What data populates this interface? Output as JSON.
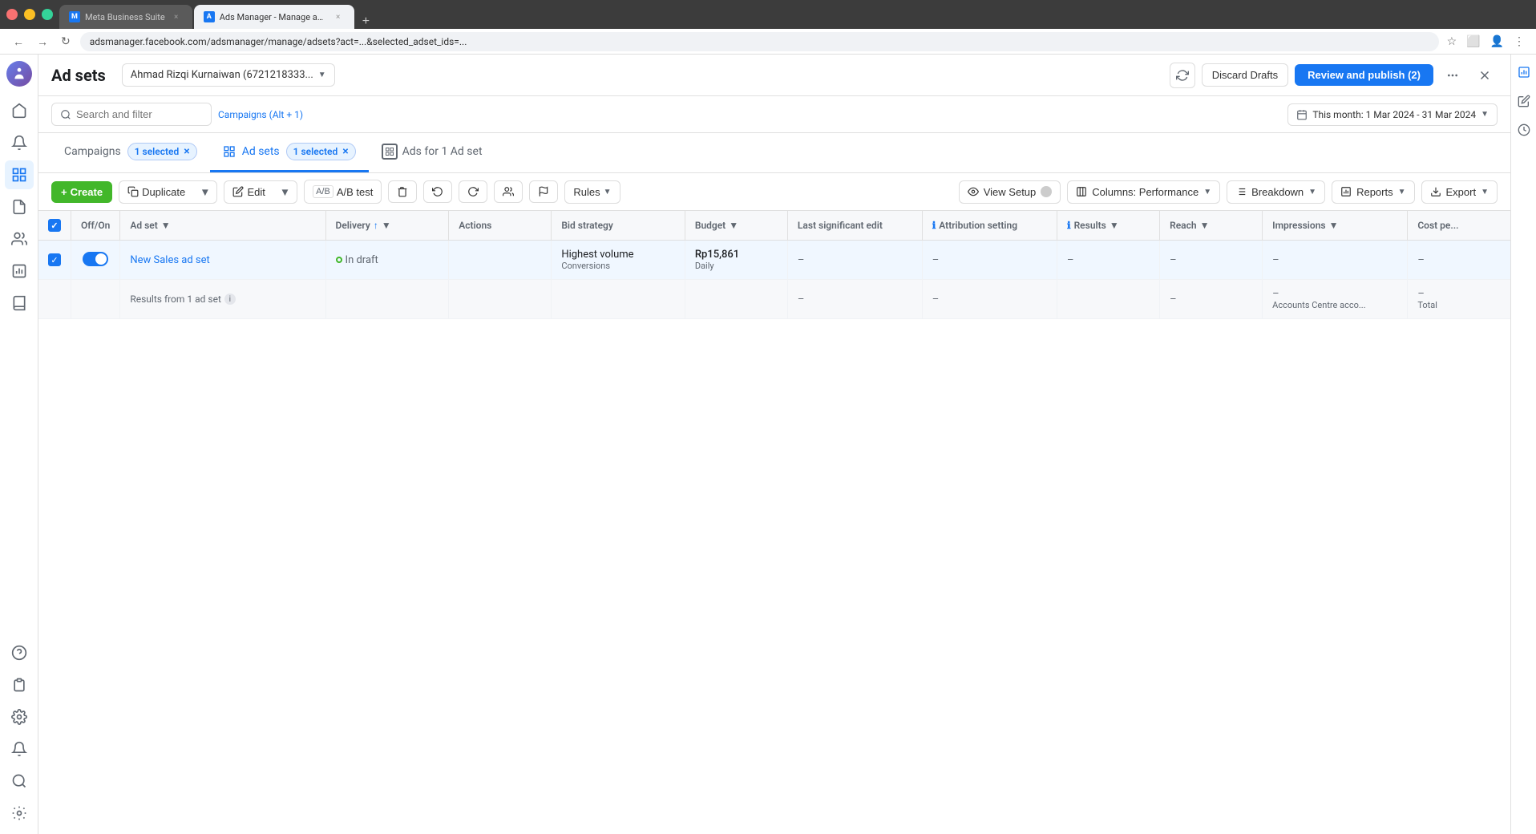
{
  "browser": {
    "tabs": [
      {
        "id": "meta",
        "title": "Meta Business Suite",
        "favicon": "M",
        "active": false
      },
      {
        "id": "ads",
        "title": "Ads Manager - Manage ads -",
        "favicon": "A",
        "active": true
      }
    ],
    "url": "adsmanager.facebook.com/adsmanager/manage/adsets?act=...&selected_adset_ids=..."
  },
  "topbar": {
    "page_title": "Ad sets",
    "account_name": "Ahmad Rizqi Kurnaiwan (6721218333...",
    "refresh_label": "↺",
    "discard_label": "Discard Drafts",
    "review_label": "Review and publish (2)",
    "more_label": "···",
    "close_label": "×"
  },
  "filter_bar": {
    "search_placeholder": "Search and filter",
    "campaigns_label": "Campaigns (Alt + 1)",
    "date_range": "This month: 1 Mar 2024 - 31 Mar 2024"
  },
  "nav_tabs": {
    "campaigns_label": "Campaigns",
    "campaigns_selected": "1 selected",
    "adsets_label": "Ad sets",
    "adsets_selected": "1 selected",
    "ads_for_label": "Ads for 1 Ad set",
    "ads_icon": "⊞"
  },
  "toolbar": {
    "create_label": "Create",
    "duplicate_label": "Duplicate",
    "edit_label": "Edit",
    "ab_test_label": "A/B test",
    "delete_label": "🗑",
    "undo_label": "↺",
    "redo_label": "↻",
    "people_label": "👥",
    "flag_label": "⚑",
    "rules_label": "Rules",
    "view_setup_label": "View Setup",
    "columns_label": "Columns: Performance",
    "breakdown_label": "Breakdown",
    "reports_label": "Reports",
    "export_label": "Export"
  },
  "table": {
    "columns": [
      {
        "id": "checkbox",
        "label": ""
      },
      {
        "id": "toggle",
        "label": "Off/On"
      },
      {
        "id": "adset",
        "label": "Ad set"
      },
      {
        "id": "delivery",
        "label": "Delivery"
      },
      {
        "id": "actions",
        "label": "Actions"
      },
      {
        "id": "bid_strategy",
        "label": "Bid strategy"
      },
      {
        "id": "budget",
        "label": "Budget"
      },
      {
        "id": "last_edit",
        "label": "Last significant edit"
      },
      {
        "id": "attribution",
        "label": "Attribution setting"
      },
      {
        "id": "results",
        "label": "Results"
      },
      {
        "id": "reach",
        "label": "Reach"
      },
      {
        "id": "impressions",
        "label": "Impressions"
      },
      {
        "id": "cost_per",
        "label": "Cost pe..."
      }
    ],
    "rows": [
      {
        "id": "1",
        "selected": true,
        "toggle_on": true,
        "adset_name": "New Sales ad set",
        "delivery": "In draft",
        "delivery_status": "draft",
        "actions": "",
        "bid_strategy": "Highest volume",
        "bid_type": "Conversions",
        "budget": "Rp15,861",
        "budget_period": "Daily",
        "last_edit": "–",
        "attribution": "–",
        "results": "–",
        "reach": "–",
        "impressions": "–",
        "cost_per": "–"
      }
    ],
    "totals_row": {
      "label": "Results from 1 ad set",
      "last_edit": "–",
      "attribution": "–",
      "reach": "–",
      "impressions_note": "Accounts Centre acco...",
      "cost_per_note": "Total"
    }
  },
  "sidebar_icons": {
    "home": "⌂",
    "notifications": "🔔",
    "grid": "⊞",
    "pages": "📄",
    "people": "👥",
    "reports": "📊",
    "books": "📚",
    "menu": "☰"
  },
  "right_sidebar": {
    "chart": "📊",
    "edit": "✏",
    "clock": "🕐"
  }
}
